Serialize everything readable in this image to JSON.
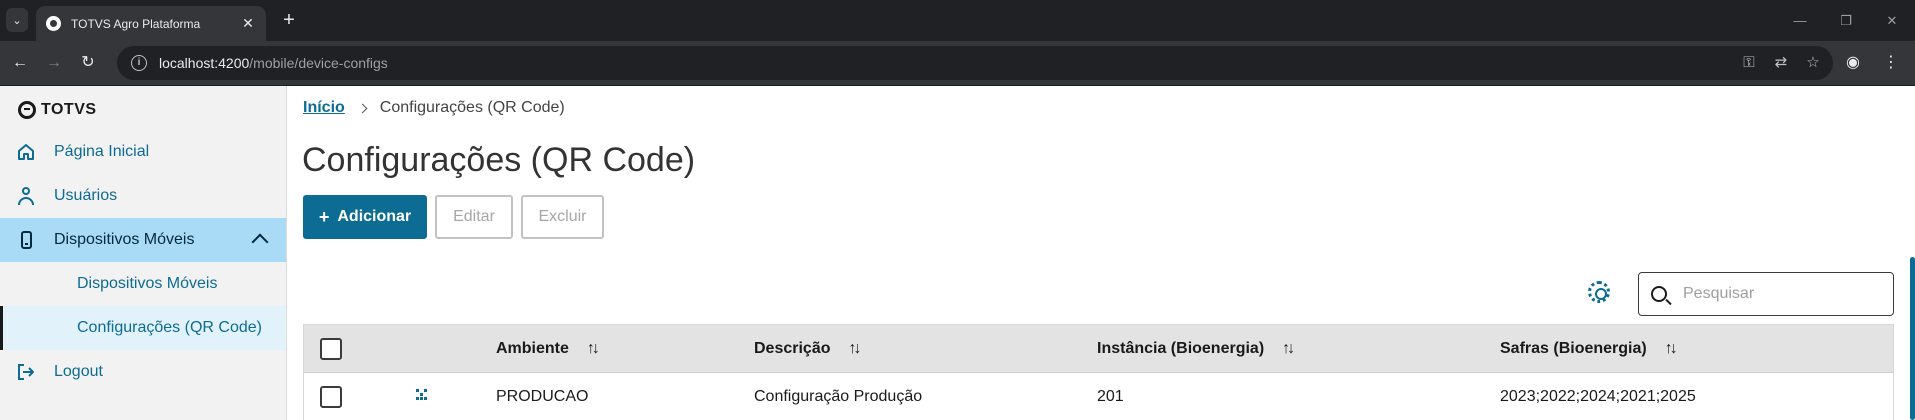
{
  "browser": {
    "tab_title": "TOTVS Agro Plataforma",
    "url_host": "localhost:4200",
    "url_path": "/mobile/device-configs"
  },
  "sidebar": {
    "logo_text": "TOTVS",
    "items": [
      {
        "label": "Página Inicial",
        "icon": "home-icon"
      },
      {
        "label": "Usuários",
        "icon": "user-icon"
      },
      {
        "label": "Dispositivos Móveis",
        "icon": "mobile-device-icon",
        "expanded": true
      },
      {
        "label": "Logout",
        "icon": "logout-icon"
      }
    ],
    "subitems": [
      {
        "label": "Dispositivos Móveis"
      },
      {
        "label": "Configurações (QR Code)",
        "selected": true
      }
    ]
  },
  "breadcrumb": {
    "home": "Início",
    "current": "Configurações (QR Code)"
  },
  "page": {
    "title": "Configurações (QR Code)"
  },
  "actions": {
    "add_icon": "+",
    "add": "Adicionar",
    "edit": "Editar",
    "delete": "Excluir"
  },
  "search": {
    "placeholder": "Pesquisar"
  },
  "table": {
    "columns": [
      "Ambiente",
      "Descrição",
      "Instância (Bioenergia)",
      "Safras (Bioenergia)"
    ],
    "rows": [
      {
        "ambiente": "PRODUCAO",
        "descricao": "Configuração Produção",
        "instancia": "201",
        "safras": "2023;2022;2024;2021;2025"
      }
    ]
  },
  "colors": {
    "primary": "#0c6c94",
    "active_nav": "#a9dbf7",
    "sidebar_bg": "#f2f2f2",
    "table_header_bg": "#e3e3e3"
  }
}
